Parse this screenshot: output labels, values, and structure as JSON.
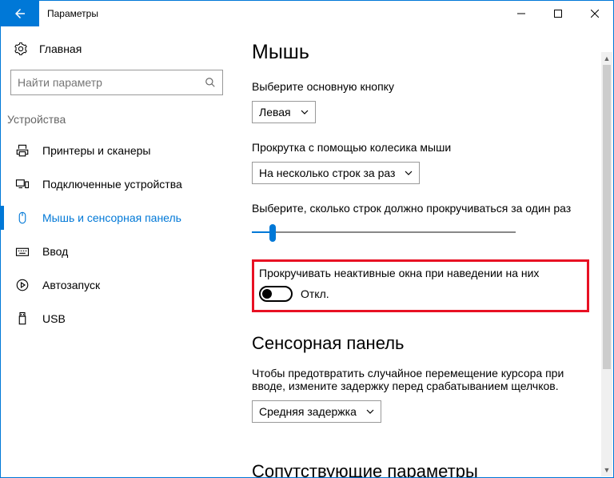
{
  "titlebar": {
    "title": "Параметры"
  },
  "sidebar": {
    "home": "Главная",
    "search_placeholder": "Найти параметр",
    "group": "Устройства",
    "items": [
      {
        "label": "Принтеры и сканеры"
      },
      {
        "label": "Подключенные устройства"
      },
      {
        "label": "Мышь и сенсорная панель"
      },
      {
        "label": "Ввод"
      },
      {
        "label": "Автозапуск"
      },
      {
        "label": "USB"
      }
    ]
  },
  "main": {
    "heading": "Мышь",
    "primary_button_label": "Выберите основную кнопку",
    "primary_button_value": "Левая",
    "scroll_wheel_label": "Прокрутка с помощью колесика мыши",
    "scroll_wheel_value": "На несколько строк за раз",
    "lines_label": "Выберите, сколько строк должно прокручиваться за один раз",
    "inactive_scroll_label": "Прокручивать неактивные окна при наведении на них",
    "inactive_scroll_state": "Откл.",
    "touchpad_heading": "Сенсорная панель",
    "touchpad_desc": "Чтобы предотвратить случайное перемещение курсора при вводе, измените задержку перед срабатыванием щелчков.",
    "touchpad_delay_value": "Средняя задержка",
    "related_heading": "Сопутствующие параметры"
  }
}
